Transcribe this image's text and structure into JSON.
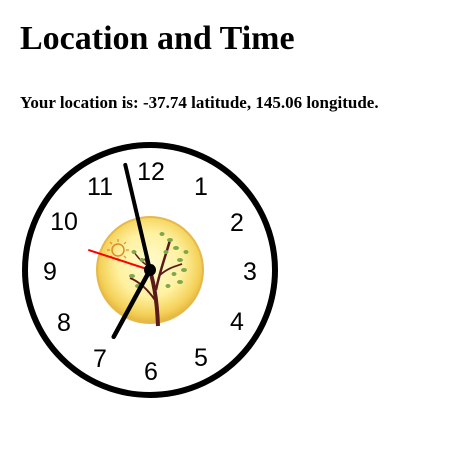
{
  "page": {
    "title": "Location and Time",
    "location_text": "Your location is: -37.74 latitude, 145.06 longitude."
  },
  "clock": {
    "numbers": [
      "12",
      "1",
      "2",
      "3",
      "4",
      "5",
      "6",
      "7",
      "8",
      "9",
      "10",
      "11"
    ],
    "time": {
      "hour": 6,
      "minute": 57,
      "second": 48
    },
    "face_image": "sun-and-tree-medallion",
    "colors": {
      "rim": "#000000",
      "face": "#ffffff",
      "hands": "#000000",
      "second_hand": "#ff0000",
      "medallion_center": "#fff6a8",
      "medallion_edge": "#e9c24a"
    }
  }
}
